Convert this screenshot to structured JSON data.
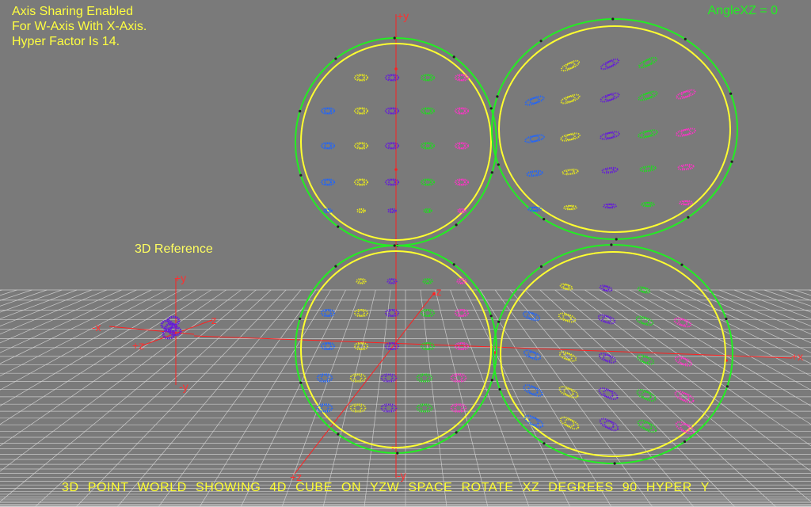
{
  "overlay": {
    "info_lines": [
      "Axis Sharing Enabled",
      "For W-Axis With X-Axis.",
      "Hyper Factor Is 14."
    ],
    "angle_readout": "AngleXZ = 0",
    "reference_label": "3D Reference",
    "caption": "3D POINT WORLD SHOWING 4D CUBE ON YZW SPACE ROTATE XZ DEGREES 90 HYPER Y"
  },
  "axis_labels": {
    "world_plus_y": "+y",
    "world_minus_z": "-z",
    "world_plus_x": "+x",
    "world_plus_z": "+z",
    "world_minus_y": "-y",
    "ref_plus_y": "+y",
    "ref_minus_x": "-x",
    "ref_minus_z": "-z",
    "ref_plus_z": "+z",
    "ref_minus_y": "-y"
  },
  "colors": {
    "background": "#7a7a7a",
    "grid": "#d8d8d8",
    "axis": "#ff2020",
    "outer_ring": "#22ee22",
    "inner_ring": "#ffff30",
    "point_palette": [
      "#1e64ff",
      "#e6e61e",
      "#6419dc",
      "#1edc1e",
      "#ff32c8"
    ]
  },
  "scene": {
    "ring_count": 4,
    "cluster_columns": 4,
    "cluster_rows": 5
  }
}
